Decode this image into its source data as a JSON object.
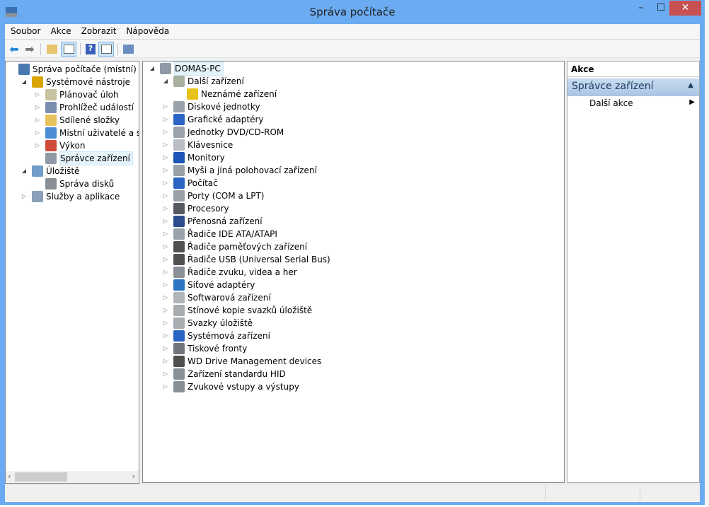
{
  "window": {
    "title": "Správa počítače",
    "minimize": "–",
    "maximize": "☐",
    "close": "✕",
    "close_color": "#c75050",
    "frame_color": "#6aabf1"
  },
  "menu": [
    "Soubor",
    "Akce",
    "Zobrazit",
    "Nápověda"
  ],
  "toolbar": [
    "back-icon",
    "forward-icon",
    "up-folder-icon",
    "show-hide-tree-icon",
    "help-icon",
    "show-hide-action-icon",
    "properties-icon"
  ],
  "left_tree": [
    {
      "label": "Správa počítače (místní)",
      "level": 0,
      "exp": "",
      "icon": "computer-management-icon",
      "color": "#4a78b0"
    },
    {
      "label": "Systémové nástroje",
      "level": 1,
      "exp": "open",
      "icon": "tools-icon",
      "color": "#d9a400"
    },
    {
      "label": "Plánovač úloh",
      "level": 2,
      "exp": "closed",
      "icon": "clock-icon",
      "color": "#c9c2a0"
    },
    {
      "label": "Prohlížeč událostí",
      "level": 2,
      "exp": "closed",
      "icon": "event-viewer-icon",
      "color": "#7a8fb0"
    },
    {
      "label": "Sdílené složky",
      "level": 2,
      "exp": "closed",
      "icon": "shared-folder-icon",
      "color": "#e6c25a"
    },
    {
      "label": "Místní uživatelé a skupiny",
      "level": 2,
      "exp": "closed",
      "icon": "users-icon",
      "color": "#4b8ed6"
    },
    {
      "label": "Výkon",
      "level": 2,
      "exp": "closed",
      "icon": "performance-icon",
      "color": "#d04b3c"
    },
    {
      "label": "Správce zařízení",
      "level": 2,
      "exp": "",
      "icon": "device-manager-icon",
      "color": "#8f9aa6",
      "selected": true
    },
    {
      "label": "Úložiště",
      "level": 1,
      "exp": "open",
      "icon": "storage-icon",
      "color": "#6f9dc8"
    },
    {
      "label": "Správa disků",
      "level": 2,
      "exp": "",
      "icon": "disk-management-icon",
      "color": "#8a8f96"
    },
    {
      "label": "Služby a aplikace",
      "level": 1,
      "exp": "closed",
      "icon": "services-icon",
      "color": "#8aa0b8"
    }
  ],
  "device_tree": [
    {
      "label": "DOMAS-PC",
      "level": 0,
      "exp": "open",
      "icon": "computer-icon",
      "color": "#8f9aa6",
      "selected": true
    },
    {
      "label": "Další zařízení",
      "level": 1,
      "exp": "open",
      "icon": "unknown-device-icon",
      "color": "#a8b0a0"
    },
    {
      "label": "Neznámé zařízení",
      "level": 2,
      "exp": "",
      "icon": "warning-device-icon",
      "color": "#e8c21a"
    },
    {
      "label": "Diskové jednotky",
      "level": 1,
      "exp": "closed",
      "icon": "disk-drive-icon",
      "color": "#9aa3ab"
    },
    {
      "label": "Grafické adaptéry",
      "level": 1,
      "exp": "closed",
      "icon": "display-adapter-icon",
      "color": "#2c64c4"
    },
    {
      "label": "Jednotky DVD/CD-ROM",
      "level": 1,
      "exp": "closed",
      "icon": "dvd-icon",
      "color": "#9aa3ab"
    },
    {
      "label": "Klávesnice",
      "level": 1,
      "exp": "closed",
      "icon": "keyboard-icon",
      "color": "#b8bec4"
    },
    {
      "label": "Monitory",
      "level": 1,
      "exp": "closed",
      "icon": "monitor-icon",
      "color": "#1c54b8"
    },
    {
      "label": "Myši a jiná polohovací zařízení",
      "level": 1,
      "exp": "closed",
      "icon": "mouse-icon",
      "color": "#9aa0a8"
    },
    {
      "label": "Počítač",
      "level": 1,
      "exp": "closed",
      "icon": "computer-icon",
      "color": "#2c64c4"
    },
    {
      "label": "Porty (COM a LPT)",
      "level": 1,
      "exp": "closed",
      "icon": "port-icon",
      "color": "#9aa0a8"
    },
    {
      "label": "Procesory",
      "level": 1,
      "exp": "closed",
      "icon": "processor-icon",
      "color": "#555a60"
    },
    {
      "label": "Přenosná zařízení",
      "level": 1,
      "exp": "closed",
      "icon": "portable-device-icon",
      "color": "#2c4c90"
    },
    {
      "label": "Řadiče IDE ATA/ATAPI",
      "level": 1,
      "exp": "closed",
      "icon": "ide-controller-icon",
      "color": "#9aa3ab"
    },
    {
      "label": "Řadiče paměťových zařízení",
      "level": 1,
      "exp": "closed",
      "icon": "storage-controller-icon",
      "color": "#505050"
    },
    {
      "label": "Řadiče USB (Universal Serial Bus)",
      "level": 1,
      "exp": "closed",
      "icon": "usb-icon",
      "color": "#505050"
    },
    {
      "label": "Řadiče zvuku, videa a her",
      "level": 1,
      "exp": "closed",
      "icon": "sound-icon",
      "color": "#8a9098"
    },
    {
      "label": "Síťové adaptéry",
      "level": 1,
      "exp": "closed",
      "icon": "network-adapter-icon",
      "color": "#2c74c4"
    },
    {
      "label": "Softwarová zařízení",
      "level": 1,
      "exp": "closed",
      "icon": "software-device-icon",
      "color": "#b0b5ba"
    },
    {
      "label": "Stínové kopie svazků úložiště",
      "level": 1,
      "exp": "closed",
      "icon": "volume-shadow-icon",
      "color": "#a8adb2"
    },
    {
      "label": "Svazky úložiště",
      "level": 1,
      "exp": "closed",
      "icon": "storage-volume-icon",
      "color": "#a8adb2"
    },
    {
      "label": "Systémová zařízení",
      "level": 1,
      "exp": "closed",
      "icon": "system-device-icon",
      "color": "#2c64c4"
    },
    {
      "label": "Tiskové fronty",
      "level": 1,
      "exp": "closed",
      "icon": "printer-icon",
      "color": "#70767c"
    },
    {
      "label": "WD Drive Management devices",
      "level": 1,
      "exp": "closed",
      "icon": "wd-device-icon",
      "color": "#505050"
    },
    {
      "label": "Zařízení standardu HID",
      "level": 1,
      "exp": "closed",
      "icon": "hid-icon",
      "color": "#8a9098"
    },
    {
      "label": "Zvukové vstupy a výstupy",
      "level": 1,
      "exp": "closed",
      "icon": "audio-io-icon",
      "color": "#8a9098"
    }
  ],
  "actions": {
    "header": "Akce",
    "section": "Správce zařízení",
    "item": "Další akce"
  }
}
